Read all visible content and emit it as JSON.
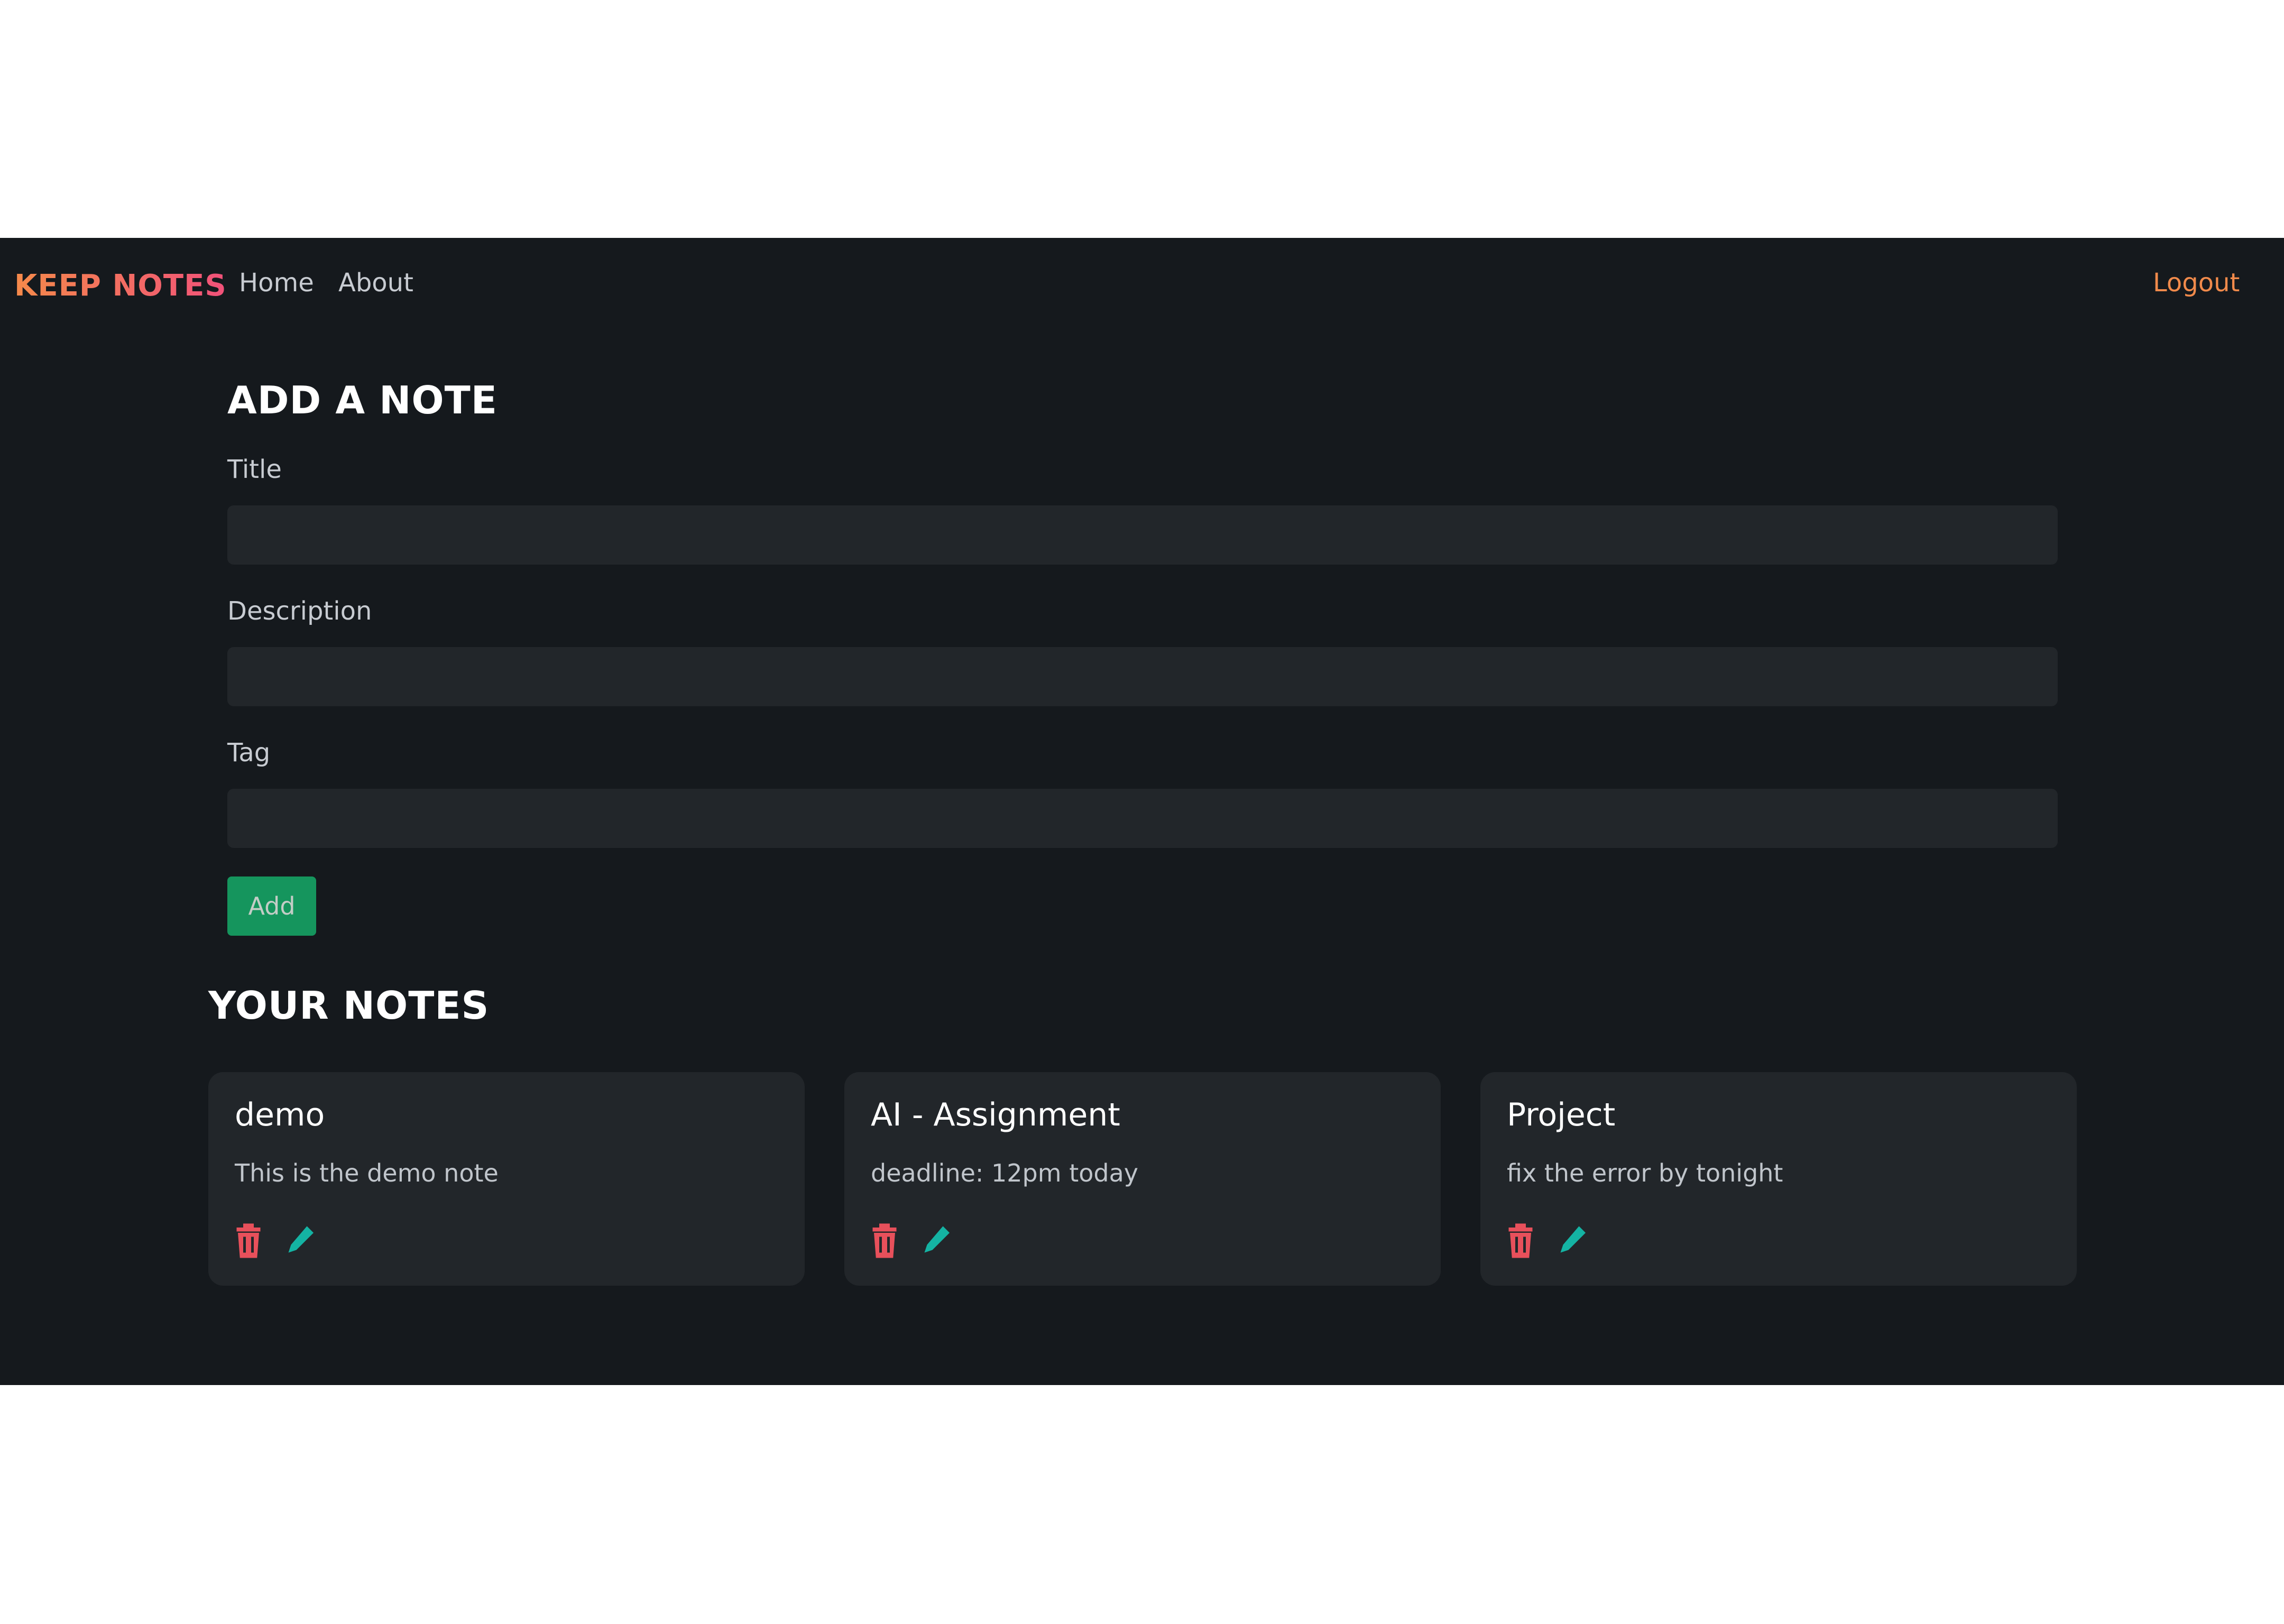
{
  "navbar": {
    "brand": "KEEP NOTES",
    "links": [
      {
        "label": "Home"
      },
      {
        "label": "About"
      }
    ],
    "logout_label": "Logout"
  },
  "form": {
    "heading": "ADD A NOTE",
    "fields": [
      {
        "label": "Title",
        "value": "",
        "placeholder": ""
      },
      {
        "label": "Description",
        "value": "",
        "placeholder": ""
      },
      {
        "label": "Tag",
        "value": "",
        "placeholder": ""
      }
    ],
    "add_label": "Add"
  },
  "notes": {
    "heading": "YOUR NOTES",
    "items": [
      {
        "title": "demo",
        "description": "This is the demo note"
      },
      {
        "title": "AI - Assignment",
        "description": "deadline: 12pm today"
      },
      {
        "title": "Project",
        "description": "fix the error by tonight"
      }
    ]
  },
  "icons": {
    "delete": "trash-icon",
    "edit": "pencil-icon"
  },
  "colors": {
    "background": "#15191d",
    "surface": "#22262a",
    "accent_orange": "#f08a4b",
    "brand_pink": "#f1517a",
    "add_green": "#15955d",
    "delete_red": "#e8505b",
    "edit_teal": "#14b3a3"
  }
}
